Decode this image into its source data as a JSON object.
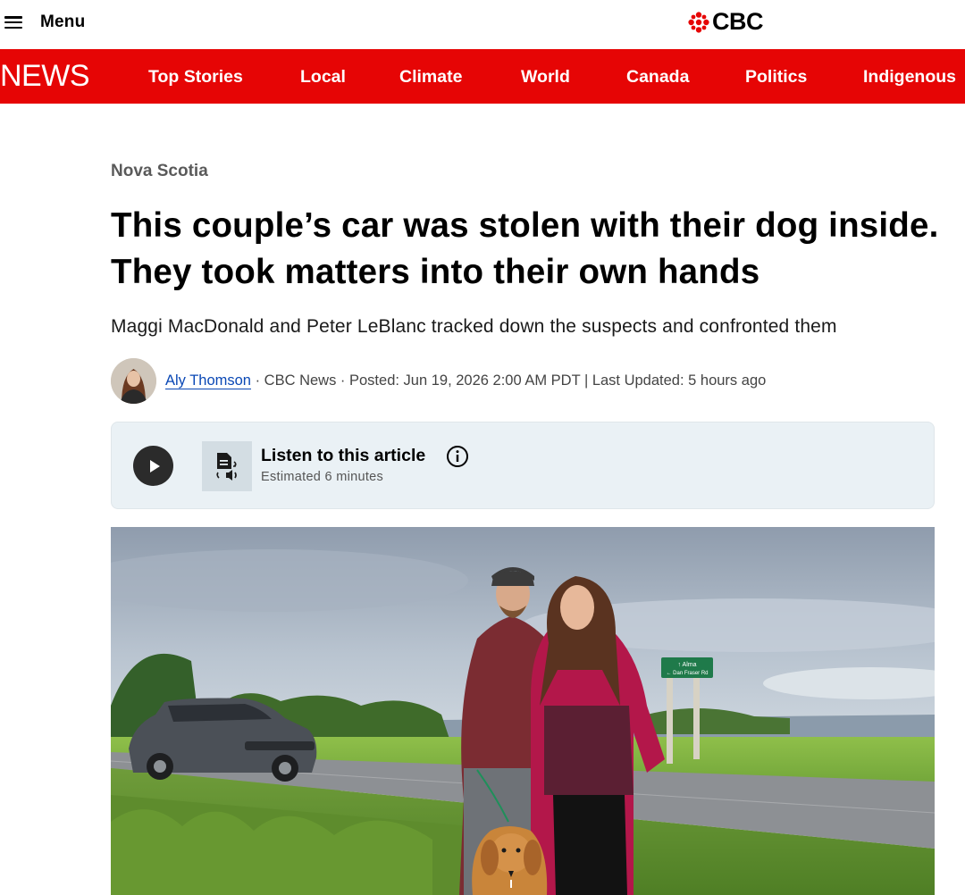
{
  "header": {
    "menu_label": "Menu",
    "brand": "CBC"
  },
  "news_nav": {
    "section_word": "NEWS",
    "items": [
      "Top Stories",
      "Local",
      "Climate",
      "World",
      "Canada",
      "Politics",
      "Indigenous"
    ]
  },
  "article": {
    "section": "Nova Scotia",
    "headline": "This couple’s car was stolen with their dog inside. They took matters into their own hands",
    "dek": "Maggi MacDonald and Peter LeBlanc tracked down the suspects and confronted them",
    "byline": {
      "author": "Aly Thomson",
      "meta": " · CBC News · Posted: Jun 19, 2026 2:00 AM PDT | Last Updated: 5 hours ago"
    },
    "listen": {
      "title": "Listen to this article",
      "estimate": "Estimated 6 minutes"
    },
    "photo": {
      "sign_line1": "↑ Alma",
      "sign_line2": "← Dan Fraser Rd"
    }
  },
  "colors": {
    "brand_red": "#e60505",
    "link_blue": "#0a48b5",
    "listen_bg": "#eaf1f5"
  }
}
